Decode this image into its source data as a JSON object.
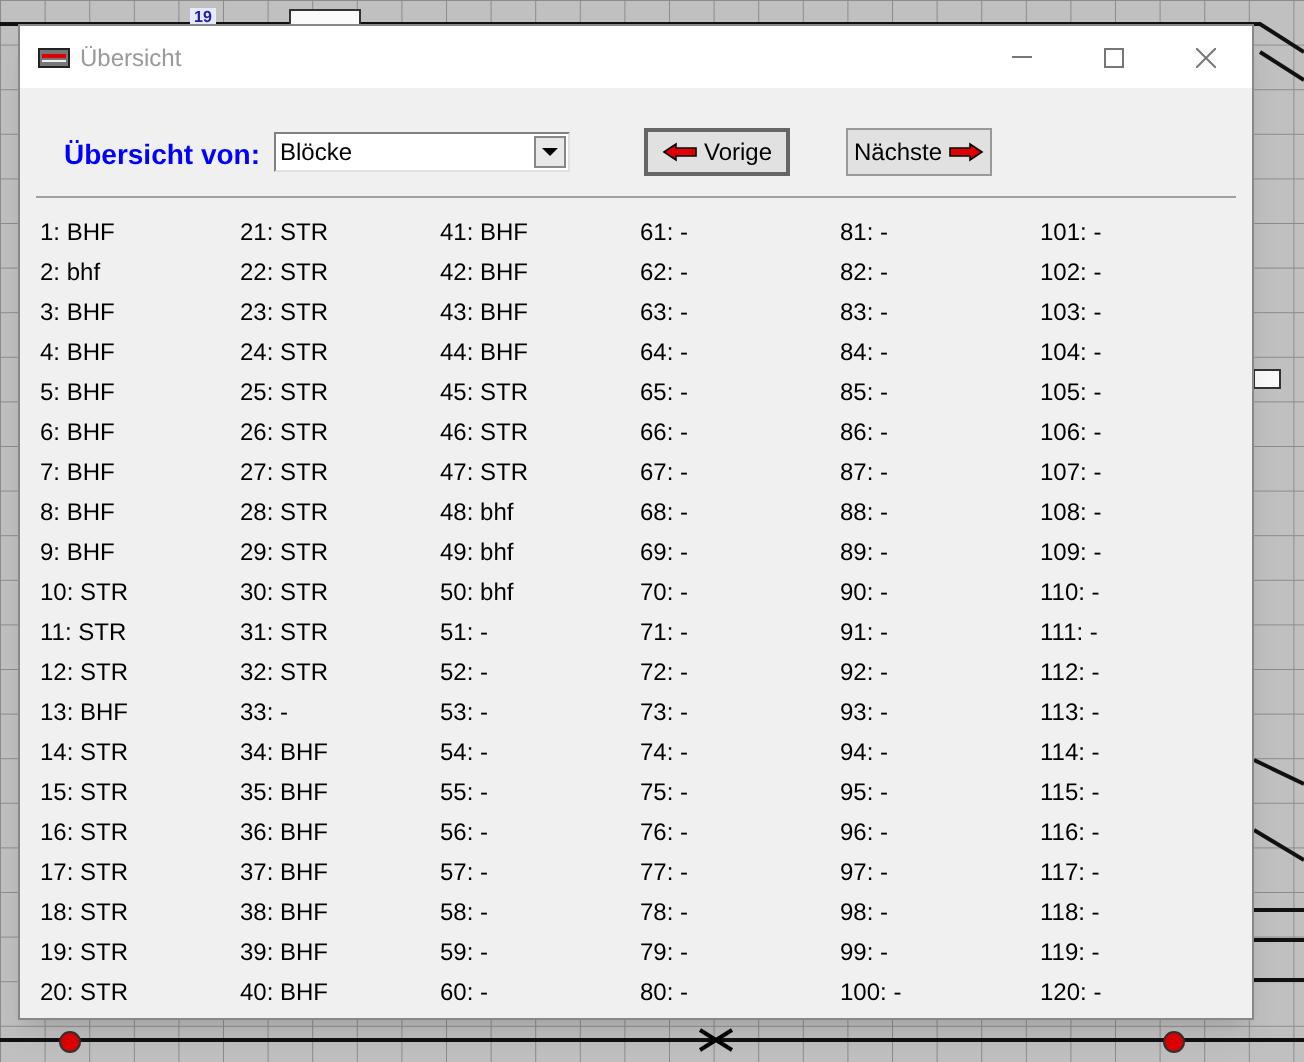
{
  "background": {
    "track_label": "19"
  },
  "window": {
    "title": "Übersicht"
  },
  "toolbar": {
    "label": "Übersicht von:",
    "dropdown": {
      "value": "Blöcke"
    },
    "buttons": [
      {
        "label": "Vorige",
        "kind": "prev"
      },
      {
        "label": "Nächste",
        "kind": "next"
      }
    ]
  },
  "entries": [
    "1: BHF",
    "2: bhf",
    "3: BHF",
    "4: BHF",
    "5: BHF",
    "6: BHF",
    "7: BHF",
    "8: BHF",
    "9: BHF",
    "10: STR",
    "11: STR",
    "12: STR",
    "13: BHF",
    "14: STR",
    "15: STR",
    "16: STR",
    "17: STR",
    "18: STR",
    "19: STR",
    "20: STR",
    "21: STR",
    "22: STR",
    "23: STR",
    "24: STR",
    "25: STR",
    "26: STR",
    "27: STR",
    "28: STR",
    "29: STR",
    "30: STR",
    "31: STR",
    "32: STR",
    "33: -",
    "34: BHF",
    "35: BHF",
    "36: BHF",
    "37: BHF",
    "38: BHF",
    "39: BHF",
    "40: BHF",
    "41: BHF",
    "42: BHF",
    "43: BHF",
    "44: BHF",
    "45: STR",
    "46: STR",
    "47: STR",
    "48: bhf",
    "49: bhf",
    "50: bhf",
    "51: -",
    "52: -",
    "53: -",
    "54: -",
    "55: -",
    "56: -",
    "57: -",
    "58: -",
    "59: -",
    "60: -",
    "61: -",
    "62: -",
    "63: -",
    "64: -",
    "65: -",
    "66: -",
    "67: -",
    "68: -",
    "69: -",
    "70: -",
    "71: -",
    "72: -",
    "73: -",
    "74: -",
    "75: -",
    "76: -",
    "77: -",
    "78: -",
    "79: -",
    "80: -",
    "81: -",
    "82: -",
    "83: -",
    "84: -",
    "85: -",
    "86: -",
    "87: -",
    "88: -",
    "89: -",
    "90: -",
    "91: -",
    "92: -",
    "93: -",
    "94: -",
    "95: -",
    "96: -",
    "97: -",
    "98: -",
    "99: -",
    "100: -",
    "101: -",
    "102: -",
    "103: -",
    "104: -",
    "105: -",
    "106: -",
    "107: -",
    "108: -",
    "109: -",
    "110: -",
    "111: -",
    "112: -",
    "113: -",
    "114: -",
    "115: -",
    "116: -",
    "117: -",
    "118: -",
    "119: -",
    "120: -"
  ]
}
